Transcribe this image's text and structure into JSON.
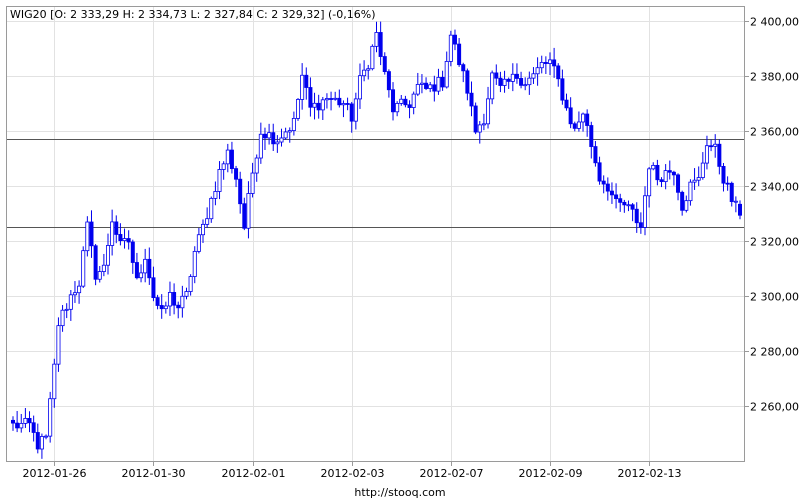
{
  "chart_data": {
    "type": "candlestick",
    "symbol": "WIG20",
    "legend": "WIG20 [O: 2 333,29  H: 2 334,73  L: 2 327,84  C: 2 329,32] (-0,16%)",
    "source": "http://stooq.com",
    "ylim": [
      2240,
      2405
    ],
    "y_ticks": [
      2260,
      2280,
      2300,
      2320,
      2340,
      2360,
      2380,
      2400
    ],
    "y_tick_labels": [
      "2 260,00",
      "2 280,00",
      "2 300,00",
      "2 320,00",
      "2 340,00",
      "2 360,00",
      "2 380,00",
      "2 400,00"
    ],
    "x_ticks": [
      {
        "index": 10,
        "label": "2012-01-26"
      },
      {
        "index": 34,
        "label": "2012-01-30"
      },
      {
        "index": 58,
        "label": "2012-02-01"
      },
      {
        "index": 82,
        "label": "2012-02-03"
      },
      {
        "index": 106,
        "label": "2012-02-07"
      },
      {
        "index": 130,
        "label": "2012-02-09"
      },
      {
        "index": 154,
        "label": "2012-02-13"
      }
    ],
    "h_lines": [
      2357,
      2325
    ],
    "candles_count": 177,
    "anchors": [
      [
        0,
        2253
      ],
      [
        4,
        2253
      ],
      [
        6,
        2246
      ],
      [
        8,
        2248
      ],
      [
        10,
        2274
      ],
      [
        11,
        2290
      ],
      [
        14,
        2300
      ],
      [
        16,
        2305
      ],
      [
        18,
        2325
      ],
      [
        20,
        2308
      ],
      [
        22,
        2310
      ],
      [
        24,
        2328
      ],
      [
        26,
        2318
      ],
      [
        28,
        2320
      ],
      [
        30,
        2305
      ],
      [
        32,
        2315
      ],
      [
        34,
        2300
      ],
      [
        36,
        2293
      ],
      [
        38,
        2300
      ],
      [
        40,
        2296
      ],
      [
        42,
        2300
      ],
      [
        44,
        2316
      ],
      [
        46,
        2325
      ],
      [
        48,
        2335
      ],
      [
        50,
        2345
      ],
      [
        52,
        2352
      ],
      [
        54,
        2343
      ],
      [
        56,
        2325
      ],
      [
        58,
        2345
      ],
      [
        60,
        2360
      ],
      [
        64,
        2357
      ],
      [
        68,
        2363
      ],
      [
        70,
        2380
      ],
      [
        72,
        2368
      ],
      [
        76,
        2372
      ],
      [
        80,
        2370
      ],
      [
        82,
        2365
      ],
      [
        84,
        2378
      ],
      [
        86,
        2385
      ],
      [
        88,
        2395
      ],
      [
        90,
        2380
      ],
      [
        92,
        2368
      ],
      [
        96,
        2370
      ],
      [
        98,
        2376
      ],
      [
        100,
        2375
      ],
      [
        104,
        2378
      ],
      [
        106,
        2395
      ],
      [
        108,
        2385
      ],
      [
        110,
        2375
      ],
      [
        112,
        2360
      ],
      [
        114,
        2365
      ],
      [
        116,
        2380
      ],
      [
        118,
        2375
      ],
      [
        122,
        2380
      ],
      [
        124,
        2378
      ],
      [
        126,
        2380
      ],
      [
        128,
        2384
      ],
      [
        130,
        2385
      ],
      [
        132,
        2378
      ],
      [
        134,
        2368
      ],
      [
        136,
        2360
      ],
      [
        138,
        2367
      ],
      [
        140,
        2355
      ],
      [
        142,
        2343
      ],
      [
        144,
        2340
      ],
      [
        146,
        2333
      ],
      [
        148,
        2333
      ],
      [
        150,
        2330
      ],
      [
        152,
        2325
      ],
      [
        154,
        2348
      ],
      [
        156,
        2343
      ],
      [
        158,
        2345
      ],
      [
        160,
        2346
      ],
      [
        162,
        2333
      ],
      [
        164,
        2340
      ],
      [
        166,
        2342
      ],
      [
        168,
        2356
      ],
      [
        170,
        2353
      ],
      [
        172,
        2343
      ],
      [
        174,
        2335
      ],
      [
        176,
        2329
      ]
    ],
    "last_candle": {
      "open": 2333.29,
      "high": 2334.73,
      "low": 2327.84,
      "close": 2329.32
    },
    "colors": {
      "up": "#ffffff",
      "down": "#0000ee",
      "outline": "#0000ee",
      "grid": "#e2e2e2",
      "axis": "#9a9a9a",
      "hline": "#555555"
    },
    "grid": true,
    "legend_placement": "top-left"
  }
}
